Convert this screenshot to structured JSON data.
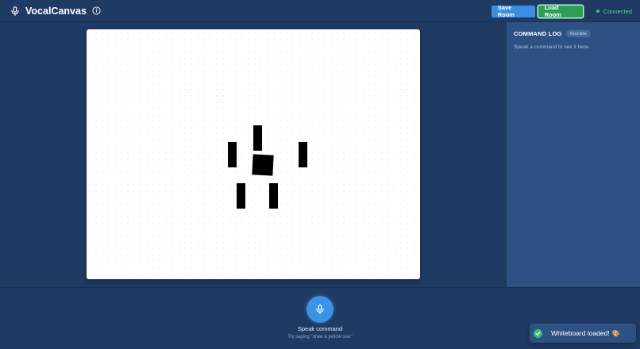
{
  "app": {
    "title": "VocalCanvas",
    "icons": {
      "brand": "microphone-icon",
      "info": "info-icon"
    }
  },
  "toolbar": {
    "save_label": "Save Room",
    "load_label": "Load Room",
    "status_label": "Connected",
    "colors": {
      "save": "#3b8fe0",
      "load": "#2e9e57",
      "status": "#38c172"
    }
  },
  "canvas": {
    "background": "#ffffff",
    "shape_color": "#000000"
  },
  "command_log": {
    "title": "COMMAND LOG",
    "badge": "Real-time",
    "empty_text": "Speak a command to see it here."
  },
  "voice": {
    "button_icon": "microphone-icon",
    "label": "Speak command",
    "hint": "Try saying \"draw a yellow star\""
  },
  "toast": {
    "message": "Whiteboard loaded!",
    "emoji": "🎨",
    "icon": "check-icon"
  }
}
